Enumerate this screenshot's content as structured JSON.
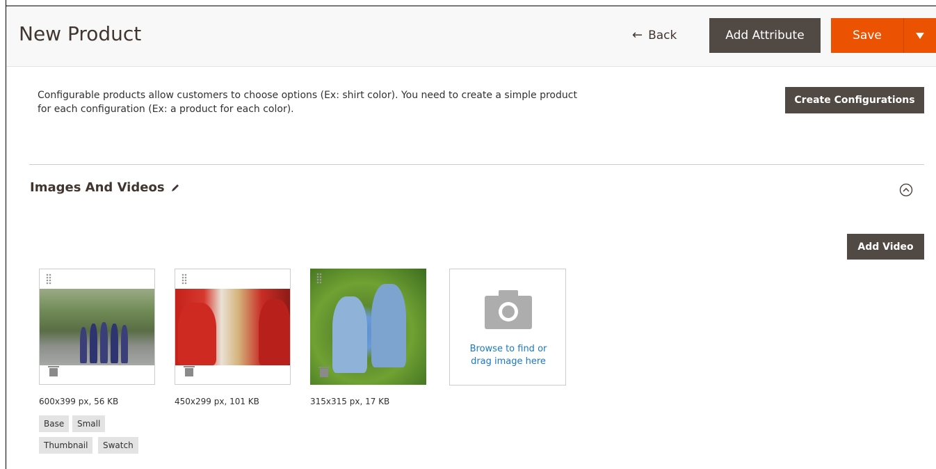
{
  "header": {
    "title": "New Product",
    "back_label": "Back",
    "add_attribute_label": "Add Attribute",
    "save_label": "Save"
  },
  "configurable": {
    "description": "Configurable products allow customers to choose options (Ex: shirt color). You need to create a simple product for each configuration (Ex: a product for each color).",
    "button_label": "Create Configurations"
  },
  "images_section": {
    "title": "Images And Videos",
    "add_video_label": "Add Video",
    "upload_text_line1": "Browse to find or",
    "upload_text_line2": "drag image here",
    "images": [
      {
        "info": "600x399 px, 56 KB"
      },
      {
        "info": "450x299 px, 101 KB"
      },
      {
        "info": "315x315 px, 17 KB"
      }
    ],
    "roles": [
      "Base",
      "Small",
      "Thumbnail",
      "Swatch"
    ]
  },
  "colors": {
    "primary_button": "#514943",
    "save_button": "#eb5202",
    "link": "#1979c3"
  },
  "icons": [
    "back-arrow-icon",
    "dropdown-arrow-icon",
    "pencil-icon",
    "collapse-chevron-icon",
    "drag-handle-icon",
    "trash-icon",
    "camera-icon"
  ]
}
